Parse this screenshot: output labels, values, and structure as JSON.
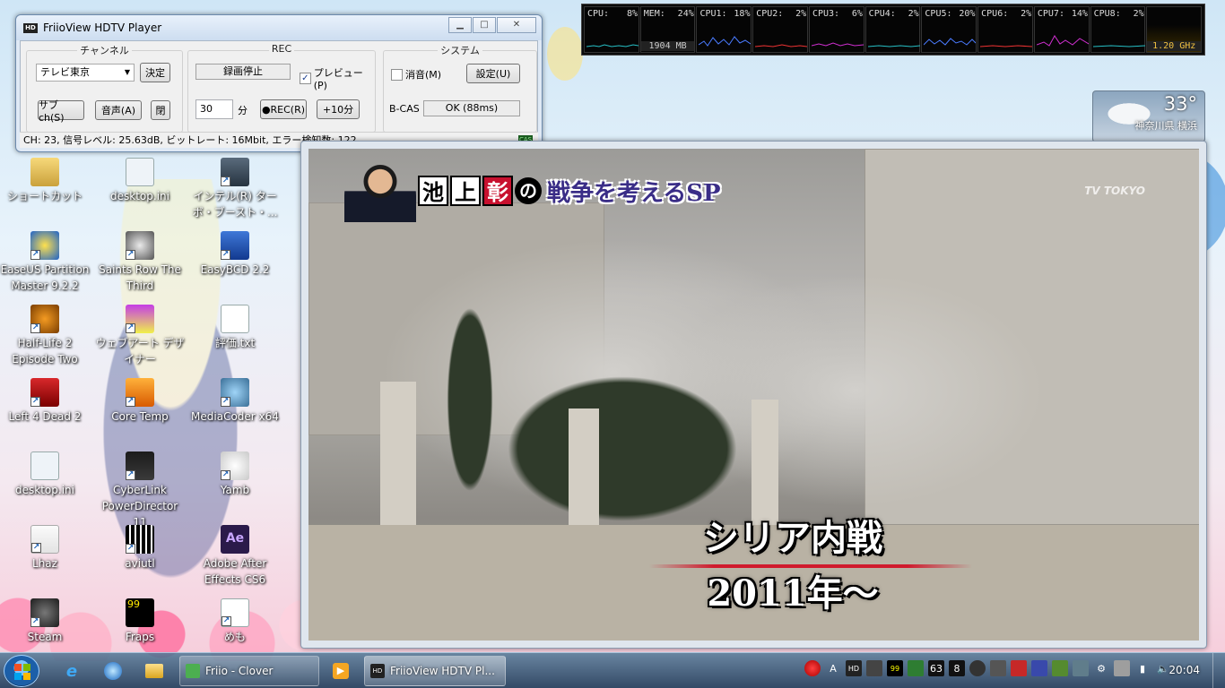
{
  "desktop": {
    "icons": [
      {
        "label": "ショートカット"
      },
      {
        "label": "desktop.ini"
      },
      {
        "label": "インテル(R) ターボ・ブースト・..."
      },
      {
        "label": "EaseUS Partition Master 9.2.2"
      },
      {
        "label": "Saints Row The Third"
      },
      {
        "label": "EasyBCD 2.2"
      },
      {
        "label": "Half-Life 2 Episode Two"
      },
      {
        "label": "ウェブアート デザイナー"
      },
      {
        "label": "評価.txt"
      },
      {
        "label": "Left 4 Dead 2"
      },
      {
        "label": "Core Temp"
      },
      {
        "label": "MediaCoder x64"
      },
      {
        "label": "desktop.ini"
      },
      {
        "label": "CyberLink PowerDirector 11"
      },
      {
        "label": "Yamb"
      },
      {
        "label": "Lhaz"
      },
      {
        "label": "aviutl"
      },
      {
        "label": "Adobe After Effects CS6"
      },
      {
        "label": "Steam"
      },
      {
        "label": "Fraps"
      },
      {
        "label": "めも"
      }
    ]
  },
  "friio": {
    "title": "FriioView HDTV Player",
    "channel_group": "チャンネル",
    "channel_value": "テレビ東京",
    "decide_btn": "決定",
    "subch_btn": "サブch(S)",
    "audio_btn": "音声(A)",
    "close_btn": "閉",
    "rec_group": "REC",
    "rec_status": "録画停止",
    "preview_label": "プレビュー(P)",
    "minutes_value": "30",
    "minutes_unit": "分",
    "rec_btn": "●REC(R)",
    "plus10_btn": "+10分",
    "system_group": "システム",
    "mute_label": "消音(M)",
    "settings_btn": "設定(U)",
    "bcas_label": "B-CAS",
    "bcas_value": "OK (88ms)",
    "status_text": "CH: 23, 信号レベル: 25.63dB, ビットレート: 16Mbit, エラー検知数: 122",
    "cas_badge": "CAS"
  },
  "perf": {
    "cells": [
      {
        "name": "CPU:",
        "value": "8%",
        "sub": ""
      },
      {
        "name": "MEM:",
        "value": "24%",
        "sub": "1904 MB"
      },
      {
        "name": "CPU1:",
        "value": "18%",
        "sub": ""
      },
      {
        "name": "CPU2:",
        "value": "2%",
        "sub": ""
      },
      {
        "name": "CPU3:",
        "value": "6%",
        "sub": ""
      },
      {
        "name": "CPU4:",
        "value": "2%",
        "sub": ""
      },
      {
        "name": "CPU5:",
        "value": "20%",
        "sub": ""
      },
      {
        "name": "CPU6:",
        "value": "2%",
        "sub": ""
      },
      {
        "name": "CPU7:",
        "value": "14%",
        "sub": ""
      },
      {
        "name": "CPU8:",
        "value": "2%",
        "sub": ""
      },
      {
        "name": "",
        "value": "",
        "sub": "1.20 GHz"
      }
    ]
  },
  "weather": {
    "temp": "33°",
    "location": "神奈川県 横浜"
  },
  "video": {
    "program_k1": "池",
    "program_k2": "上",
    "program_k3": "彰",
    "program_no": "の",
    "program_title": "戦争を考えるSP",
    "channel_logo": "TV TOKYO",
    "telop_line1": "シリア内戦",
    "telop_line2": "2011年～"
  },
  "taskbar": {
    "tasks": [
      {
        "label": "Friio - Clover"
      },
      {
        "label": "FriioView HDTV Pl..."
      }
    ],
    "tray_badges": [
      "63",
      "8"
    ],
    "clock": "20:04"
  }
}
